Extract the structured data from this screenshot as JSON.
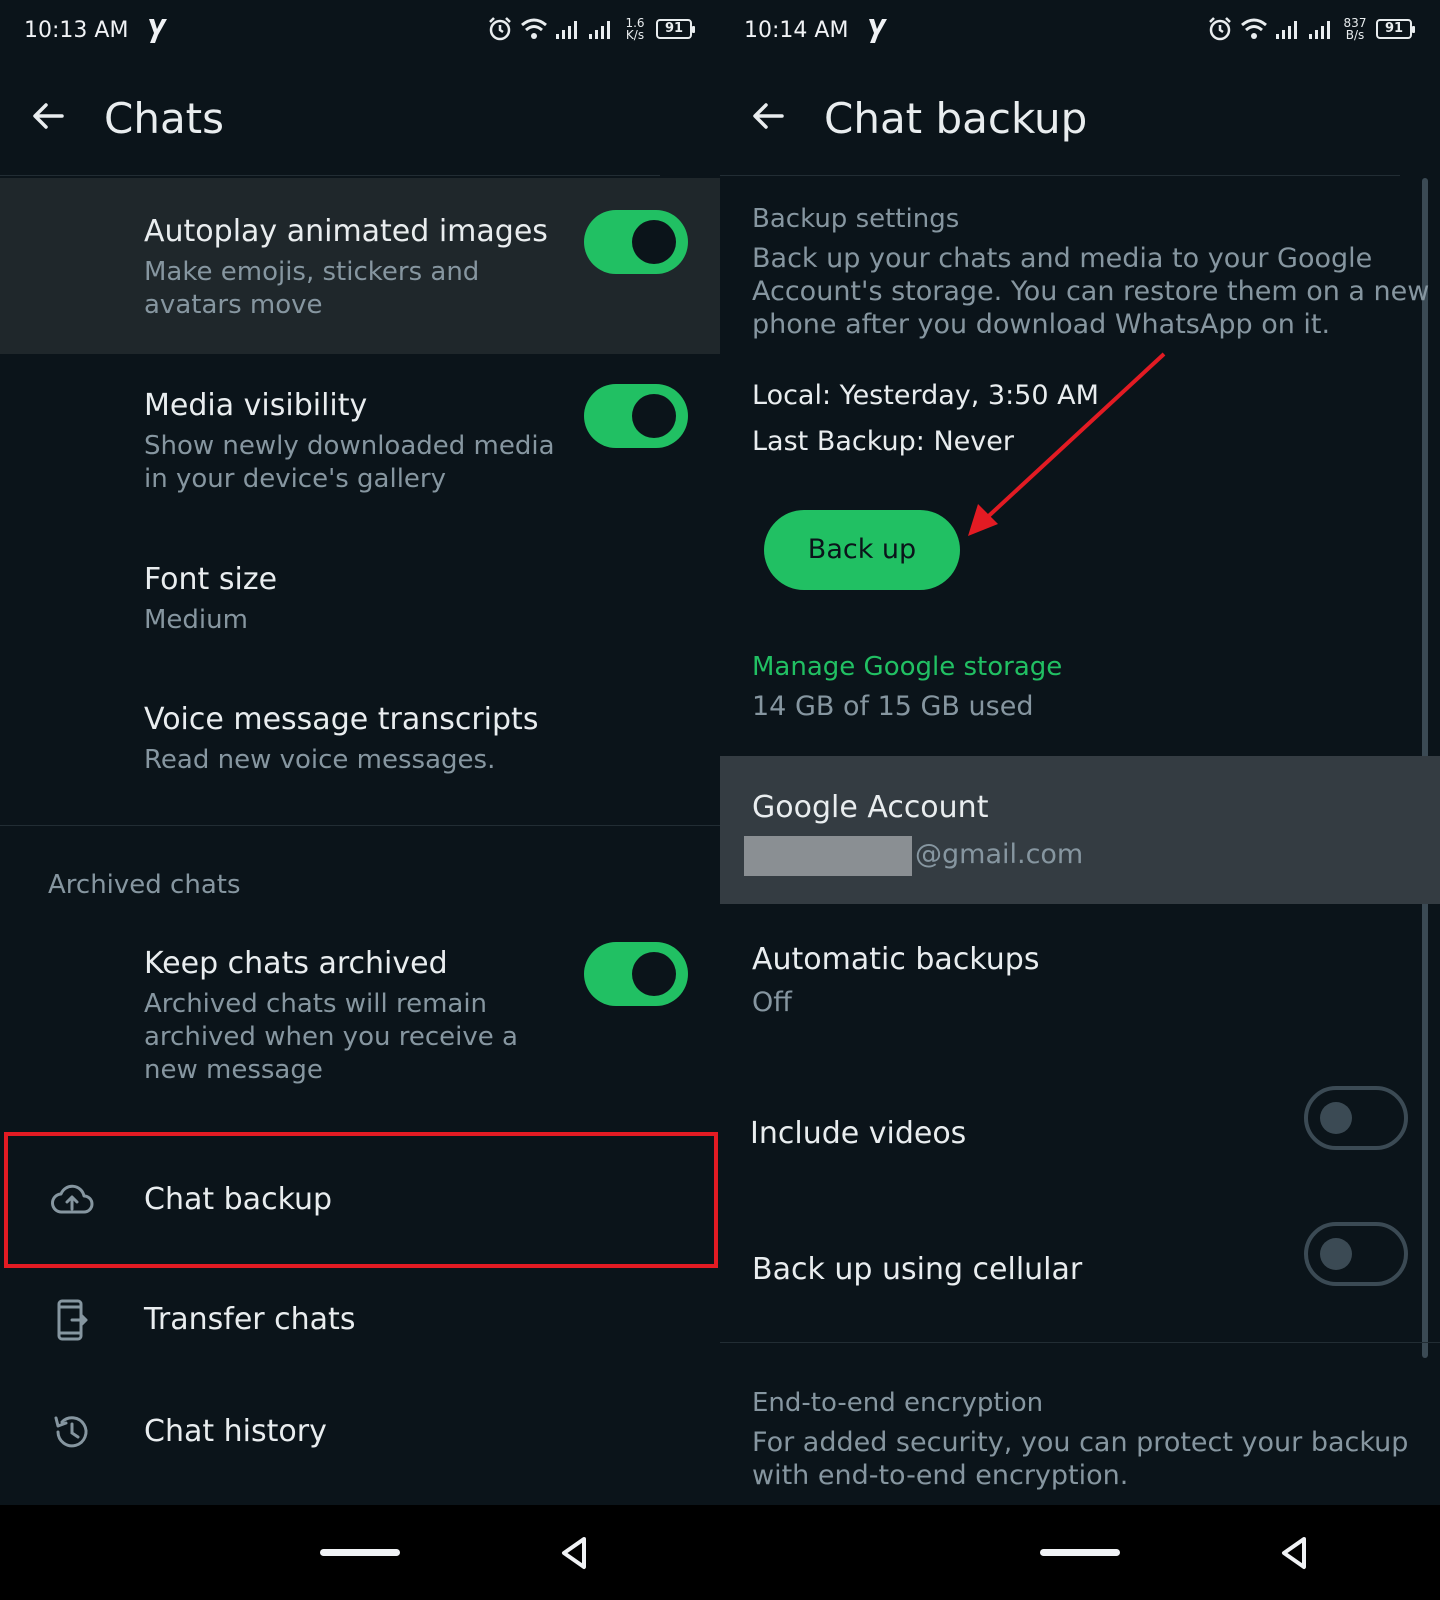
{
  "left": {
    "status": {
      "time": "10:13 AM",
      "netspeed_value": "1.6",
      "netspeed_unit": "K/s",
      "battery": "91"
    },
    "appbar": {
      "title": "Chats"
    },
    "items": {
      "autoplay": {
        "title": "Autoplay animated images",
        "sub1": "Make emojis, stickers and",
        "sub2": "avatars move",
        "enabled": true
      },
      "media": {
        "title": "Media visibility",
        "sub1": "Show newly downloaded media",
        "sub2": "in your device's gallery",
        "enabled": true
      },
      "font": {
        "title": "Font size",
        "sub": "Medium"
      },
      "voice": {
        "title": "Voice message transcripts",
        "sub": "Read new voice messages."
      },
      "archived_label": "Archived chats",
      "keep_archived": {
        "title": "Keep chats archived",
        "sub1": "Archived chats will remain",
        "sub2": "archived when you receive a",
        "sub3": "new message",
        "enabled": true
      },
      "chat_backup": {
        "title": "Chat backup",
        "icon": "cloud-upload-icon"
      },
      "transfer": {
        "title": "Transfer chats",
        "icon": "phone-transfer-icon"
      },
      "history": {
        "title": "Chat history",
        "icon": "history-icon"
      }
    }
  },
  "right": {
    "status": {
      "time": "10:14 AM",
      "netspeed_value": "837",
      "netspeed_unit": "B/s",
      "battery": "91"
    },
    "appbar": {
      "title": "Chat backup"
    },
    "backup_settings": {
      "label": "Backup settings",
      "desc1": "Back up your chats and media to your Google",
      "desc2": "Account's storage. You can restore them on a new",
      "desc3": "phone after you download WhatsApp on it.",
      "local": "Local: Yesterday, 3:50 AM",
      "last": "Last Backup: Never",
      "button": "Back up"
    },
    "storage": {
      "link": "Manage Google storage",
      "used": "14 GB of 15 GB used"
    },
    "account": {
      "title": "Google Account",
      "email_suffix": "@gmail.com"
    },
    "auto": {
      "title": "Automatic backups",
      "value": "Off"
    },
    "videos": {
      "title": "Include videos",
      "enabled": false
    },
    "cellular": {
      "title": "Back up using cellular",
      "enabled": false
    },
    "e2e": {
      "label": "End-to-end encryption",
      "desc1": "For added security, you can protect your backup",
      "desc2": "with end-to-end encryption."
    }
  },
  "colors": {
    "accent": "#21c063",
    "background": "#0b141a",
    "highlight": "#e31b23",
    "annotation_arrow": "#e31b23"
  }
}
